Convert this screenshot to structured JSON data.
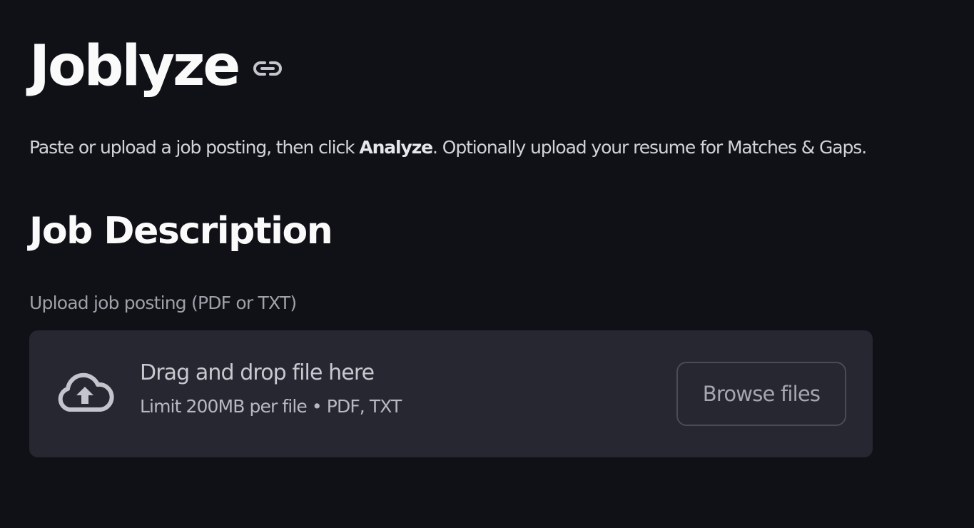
{
  "header": {
    "title": "Joblyze",
    "anchor_icon": "link-icon"
  },
  "intro": {
    "before": "Paste or upload a job posting, then click ",
    "bold": "Analyze",
    "after": ". Optionally upload your resume for Matches & Gaps."
  },
  "job_description": {
    "heading": "Job Description",
    "upload_label": "Upload job posting (PDF or TXT)",
    "dropzone": {
      "icon": "cloud-upload-icon",
      "main_text": "Drag and drop file here",
      "sub_text": "Limit 200MB per file • PDF, TXT",
      "button_label": "Browse files"
    }
  },
  "colors": {
    "background": "#0f1117",
    "dropzone": "#262730",
    "text": "#fafafa"
  }
}
